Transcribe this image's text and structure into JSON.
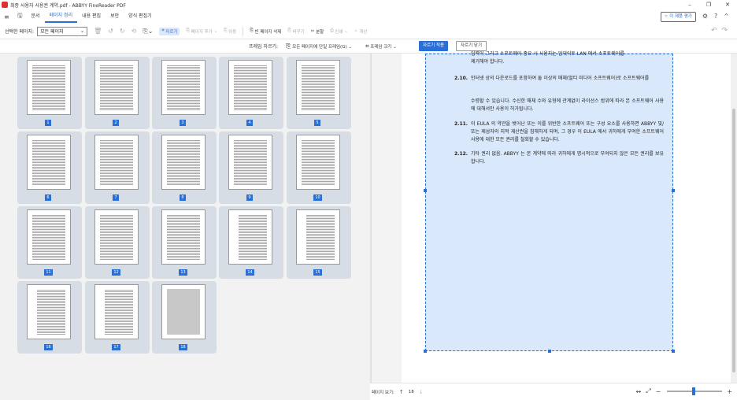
{
  "window": {
    "title": "최종 사용자 사용권 계약.pdf - ABBYY FineReader PDF",
    "min_label": "–",
    "max_label": "❐",
    "close_label": "✕"
  },
  "menu": {
    "items": [
      "문서",
      "페이지 정리",
      "내용 편집",
      "보안",
      "양식 편집기"
    ],
    "active_index": 1,
    "rate_label": "이 제품 평가",
    "settings_label": "⚙",
    "help_label": "?",
    "collapse_label": "^"
  },
  "toolbar1": {
    "selected_pages_label": "선택한 페이지:",
    "selected_pages_value": "모든 페이지",
    "crop_label": "자르기",
    "add_page_label": "페이지 추가",
    "move_label": "이동",
    "delete_blank_label": "빈 페이지 삭제",
    "replace_label": "바꾸기",
    "split_label": "분할",
    "print_label": "인쇄",
    "improve_label": "개선"
  },
  "toolbar2": {
    "frame_crop_label": "프레임 자르기:",
    "same_frame_label": "모든 페이지에 단일 프레임(G)",
    "frame_size_label": "프레임 크기",
    "apply_label": "자르기 적용",
    "close_label": "자르기 닫기"
  },
  "thumbnails": [
    "1",
    "2",
    "3",
    "4",
    "5",
    "6",
    "7",
    "8",
    "9",
    "10",
    "11",
    "12",
    "13",
    "14",
    "15",
    "16",
    "17",
    "18"
  ],
  "document": {
    "top_fragment_1": "입력이 그리고 소프트웨어 중요 시 사용자는 업데이트 LAN 에서 소프트웨어를",
    "top_fragment_2": "제거해야 합니다.",
    "s210_num": "2.10.",
    "s210_text": "인터넷 상의 다운로드를 포함하여 둘 이상의 매체(멀티 미디어 소프트웨어)로 소프트웨어를",
    "s210_text2": "수령할 수 있습니다. 수신한 매체 수와 유형에 관계없이 라이선스 범위에 따라 본 소프트웨어 사용에 대해서만 사용이 허가됩니다.",
    "s211_num": "2.11.",
    "s211_text": "이 EULA 의 약관을 벗어난 또는 이를 위반한 소프트웨어 또는 구성 요소를 사용하면 ABBYY 및/또는 제삼자의 지적 재산권을 침해하게 되며, 그 경우 이 EULA 에서 귀하에게 부여한 소프트웨어 사용에 대한 모든 권리를 철회할 수 있습니다.",
    "s212_num": "2.12.",
    "s212_text": "기타 권리 없음. ABBYY 는 본 계약에 따라 귀하에게 명시적으로 부여되지 않은 모든 권리를 보유합니다."
  },
  "status": {
    "page_view_label": "페이지 보기:",
    "current_page": "18",
    "up_arrow": "↑",
    "down_arrow": "↓"
  }
}
